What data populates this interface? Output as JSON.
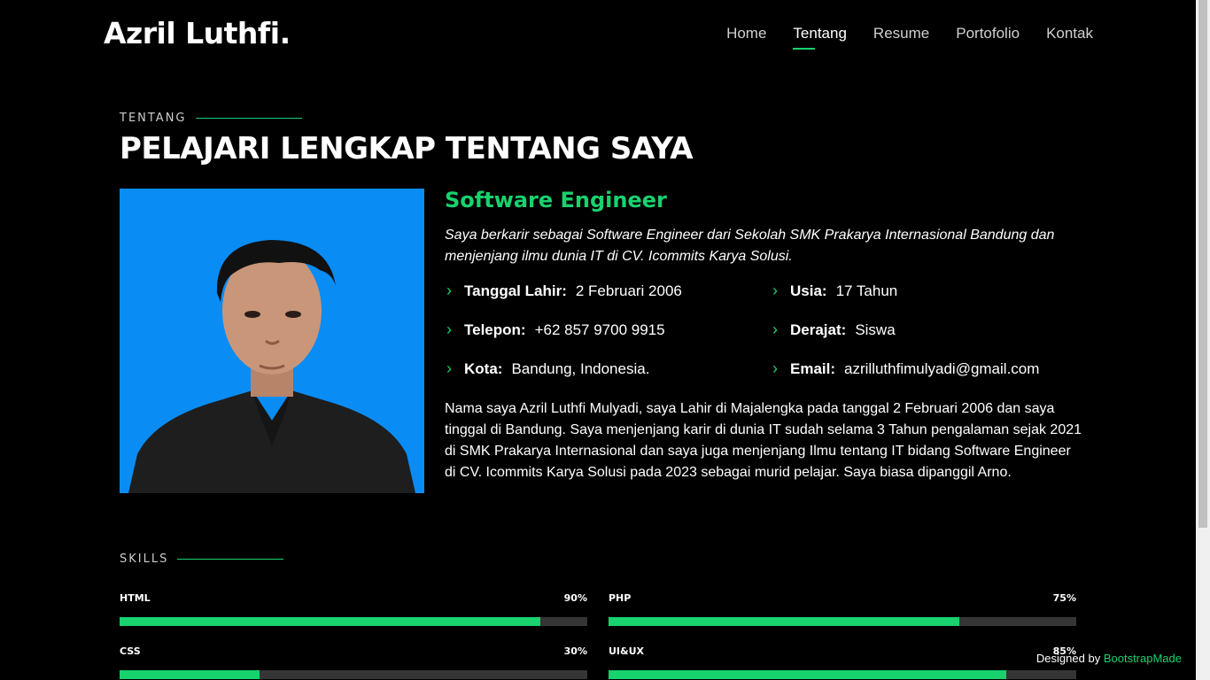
{
  "header": {
    "logo": "Azril Luthfi.",
    "nav": [
      "Home",
      "Tentang",
      "Resume",
      "Portofolio",
      "Kontak"
    ],
    "active": "Tentang"
  },
  "about": {
    "section_label": "TENTANG",
    "title": "PELAJARI LENGKAP TENTANG SAYA",
    "role": "Software Engineer",
    "intro": "Saya berkarir sebagai Software Engineer dari Sekolah SMK Prakarya Internasional Bandung dan menjenjang ilmu dunia IT di CV. Icommits Karya Solusi.",
    "info": {
      "birth_label": "Tanggal Lahir:",
      "birth_value": "2 Februari 2006",
      "phone_label": "Telepon:",
      "phone_value": "+62 857 9700 9915",
      "city_label": "Kota:",
      "city_value": "Bandung, Indonesia.",
      "age_label": "Usia:",
      "age_value": "17 Tahun",
      "degree_label": "Derajat:",
      "degree_value": "Siswa",
      "email_label": "Email:",
      "email_value": "azrilluthfimulyadi@gmail.com"
    },
    "bio": "Nama saya Azril Luthfi Mulyadi, saya Lahir di Majalengka pada tanggal 2 Februari 2006 dan saya tinggal di Bandung. Saya menjenjang karir di dunia IT sudah selama 3 Tahun pengalaman sejak 2021 di SMK Prakarya Internasional dan saya juga menjenjang Ilmu tentang IT bidang Software Engineer di CV. Icommits Karya Solusi pada 2023 sebagai murid pelajar. Saya biasa dipanggil Arno."
  },
  "skills": {
    "section_label": "SKILLS",
    "items": [
      {
        "name": "HTML",
        "percent_label": "90%",
        "value": 90
      },
      {
        "name": "PHP",
        "percent_label": "75%",
        "value": 75
      },
      {
        "name": "CSS",
        "percent_label": "30%",
        "value": 30
      },
      {
        "name": "UI&UX",
        "percent_label": "85%",
        "value": 85
      }
    ]
  },
  "footer": {
    "credit_prefix": "Designed by",
    "credit_link": "BootstrapMade"
  },
  "colors": {
    "accent": "#18d26e",
    "background": "#000000",
    "photo_background": "#0a8cf5"
  }
}
